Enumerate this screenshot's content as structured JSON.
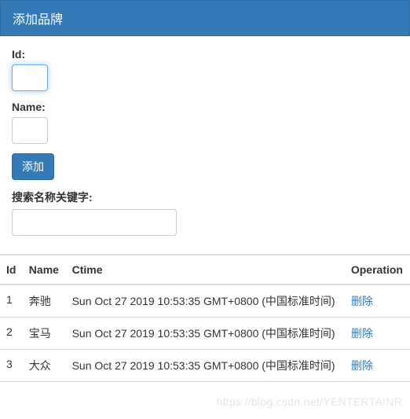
{
  "panel": {
    "title": "添加品牌"
  },
  "form": {
    "id_label": "Id:",
    "name_label": "Name:",
    "add_button": "添加",
    "search_label": "搜索名称关键字:"
  },
  "table": {
    "headers": {
      "id": "Id",
      "name": "Name",
      "ctime": "Ctime",
      "operation": "Operation"
    },
    "rows": [
      {
        "id": "1",
        "name": "奔驰",
        "ctime": "Sun Oct 27 2019 10:53:35 GMT+0800 (中国标准时间)",
        "op": "删除"
      },
      {
        "id": "2",
        "name": "宝马",
        "ctime": "Sun Oct 27 2019 10:53:35 GMT+0800 (中国标准时间)",
        "op": "删除"
      },
      {
        "id": "3",
        "name": "大众",
        "ctime": "Sun Oct 27 2019 10:53:35 GMT+0800 (中国标准时间)",
        "op": "删除"
      }
    ]
  },
  "watermark": "https://blog.csdn.net/YENTERTAINR"
}
